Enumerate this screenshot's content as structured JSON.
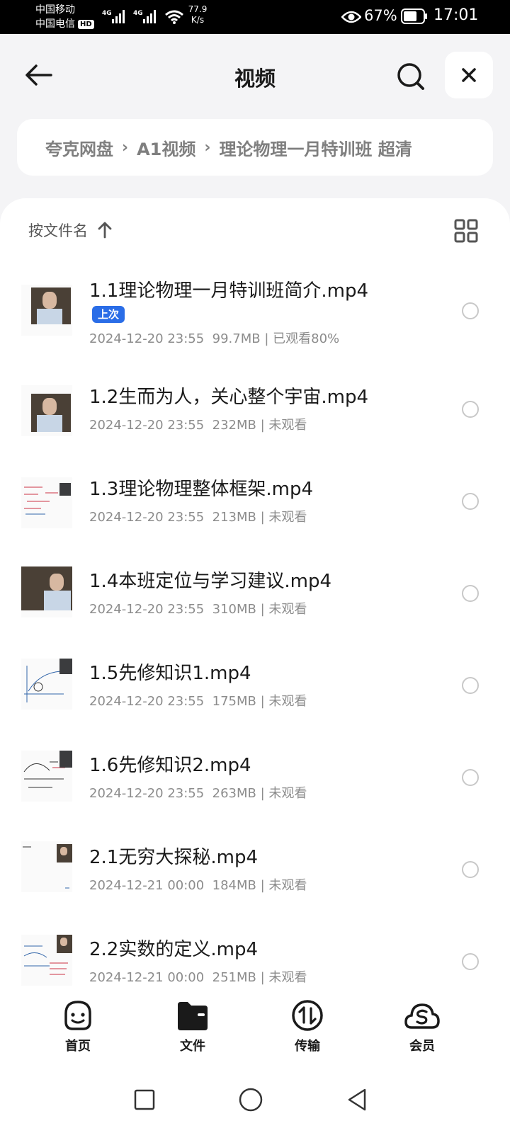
{
  "status_bar": {
    "carrier1": "中国移动",
    "carrier2": "中国电信",
    "hd": "HD",
    "signal_label": "4G",
    "net_speed_value": "77.9",
    "net_speed_unit": "K/s",
    "battery_percent": "67%",
    "time": "17:01"
  },
  "header": {
    "title": "视频",
    "icons": {
      "back": "arrow-left-icon",
      "search": "search-icon",
      "close": "close-icon"
    }
  },
  "breadcrumb": [
    "夸克网盘",
    "A1视频",
    "理论物理一月特训班 超清"
  ],
  "sort": {
    "label": "按文件名",
    "direction": "ascending"
  },
  "files": [
    {
      "name": "1.1理论物理一月特训班简介.mp4",
      "badge": "上次",
      "date": "2024-12-20 23:55",
      "size": "99.7MB",
      "status": "已观看80%"
    },
    {
      "name": "1.2生而为人，关心整个宇宙.mp4",
      "date": "2024-12-20 23:55",
      "size": "232MB",
      "status": "未观看"
    },
    {
      "name": "1.3理论物理整体框架.mp4",
      "date": "2024-12-20 23:55",
      "size": "213MB",
      "status": "未观看"
    },
    {
      "name": "1.4本班定位与学习建议.mp4",
      "date": "2024-12-20 23:55",
      "size": "310MB",
      "status": "未观看"
    },
    {
      "name": "1.5先修知识1.mp4",
      "date": "2024-12-20 23:55",
      "size": "175MB",
      "status": "未观看"
    },
    {
      "name": "1.6先修知识2.mp4",
      "date": "2024-12-20 23:55",
      "size": "263MB",
      "status": "未观看"
    },
    {
      "name": "2.1无穷大探秘.mp4",
      "date": "2024-12-21 00:00",
      "size": "184MB",
      "status": "未观看"
    },
    {
      "name": "2.2实数的定义.mp4",
      "date": "2024-12-21 00:00",
      "size": "251MB",
      "status": "未观看"
    }
  ],
  "bottom_nav": [
    {
      "label": "首页",
      "icon": "smiley-home-icon"
    },
    {
      "label": "文件",
      "icon": "folder-icon",
      "active": true
    },
    {
      "label": "传输",
      "icon": "transfer-arrows-icon"
    },
    {
      "label": "会员",
      "icon": "cloud-member-icon"
    }
  ],
  "system_nav": {
    "icons": [
      "recent-apps-icon",
      "home-circle-icon",
      "back-triangle-icon"
    ]
  }
}
